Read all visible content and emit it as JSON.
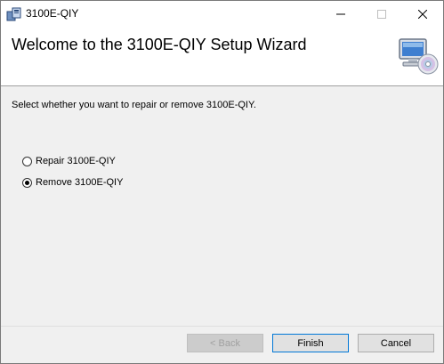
{
  "window": {
    "title": "3100E-QIY",
    "min_icon": "minimize-icon",
    "max_icon": "maximize-icon",
    "close_icon": "close-icon"
  },
  "header": {
    "title": "Welcome to the 3100E-QIY Setup Wizard",
    "image": "computer-disc-icon"
  },
  "body": {
    "prompt": "Select whether you want to repair or remove 3100E-QIY.",
    "options": [
      {
        "label": "Repair 3100E-QIY",
        "checked": false
      },
      {
        "label": "Remove 3100E-QIY",
        "checked": true
      }
    ]
  },
  "buttons": {
    "back": "< Back",
    "finish": "Finish",
    "cancel": "Cancel"
  },
  "colors": {
    "accent": "#0078d7",
    "header_bg": "#ffffff",
    "body_bg": "#f0f0f0"
  }
}
